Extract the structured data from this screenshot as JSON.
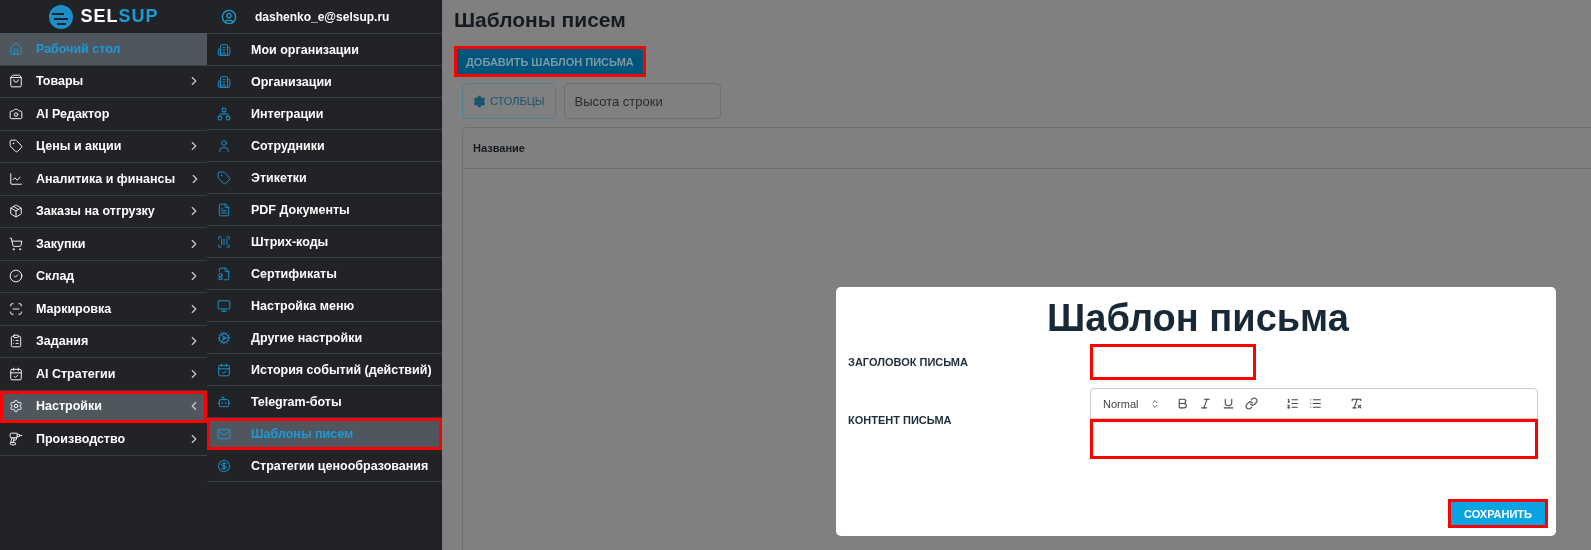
{
  "logo": {
    "first": "SEL",
    "second": "SUP"
  },
  "sidebar": {
    "items": [
      {
        "kind": "link",
        "label": "Рабочий стол",
        "selected": true,
        "highlighted": false
      },
      {
        "kind": "group",
        "label": "Товары",
        "selected": false,
        "expanded": false,
        "highlighted": false
      },
      {
        "kind": "link",
        "label": "AI Редактор",
        "selected": false,
        "highlighted": false
      },
      {
        "kind": "group",
        "label": "Цены и акции",
        "selected": false,
        "expanded": false,
        "highlighted": false
      },
      {
        "kind": "group",
        "label": "Аналитика и финансы",
        "selected": false,
        "expanded": false,
        "highlighted": false
      },
      {
        "kind": "group",
        "label": "Заказы на отгрузку",
        "selected": false,
        "expanded": false,
        "highlighted": false
      },
      {
        "kind": "group",
        "label": "Закупки",
        "selected": false,
        "expanded": false,
        "highlighted": false
      },
      {
        "kind": "group",
        "label": "Склад",
        "selected": false,
        "expanded": false,
        "highlighted": false
      },
      {
        "kind": "group",
        "label": "Маркировка",
        "selected": false,
        "expanded": false,
        "highlighted": false
      },
      {
        "kind": "group",
        "label": "Задания",
        "selected": false,
        "expanded": false,
        "highlighted": false
      },
      {
        "kind": "group",
        "label": "AI Стратегии",
        "selected": false,
        "expanded": false,
        "highlighted": false
      },
      {
        "kind": "group",
        "label": "Настройки",
        "selected": true,
        "expanded": true,
        "highlighted": true
      },
      {
        "kind": "group",
        "label": "Производство",
        "selected": false,
        "expanded": false,
        "highlighted": false
      }
    ]
  },
  "submenu": {
    "user": "dashenko_e@selsup.ru",
    "items": [
      {
        "label": "Мои организации",
        "selected": false,
        "highlighted": false
      },
      {
        "label": "Организации",
        "selected": false,
        "highlighted": false
      },
      {
        "label": "Интеграции",
        "selected": false,
        "highlighted": false
      },
      {
        "label": "Сотрудники",
        "selected": false,
        "highlighted": false
      },
      {
        "label": "Этикетки",
        "selected": false,
        "highlighted": false
      },
      {
        "label": "PDF Документы",
        "selected": false,
        "highlighted": false
      },
      {
        "label": "Штрих-коды",
        "selected": false,
        "highlighted": false
      },
      {
        "label": "Сертификаты",
        "selected": false,
        "highlighted": false
      },
      {
        "label": "Настройка меню",
        "selected": false,
        "highlighted": false
      },
      {
        "label": "Другие настройки",
        "selected": false,
        "highlighted": false
      },
      {
        "label": "История событий (действий)",
        "selected": false,
        "highlighted": false
      },
      {
        "label": "Telegram-боты",
        "selected": false,
        "highlighted": false
      },
      {
        "label": "Шаблоны писем",
        "selected": true,
        "highlighted": true
      },
      {
        "label": "Стратегии ценообразования",
        "selected": false,
        "highlighted": false
      }
    ]
  },
  "page": {
    "title": "Шаблоны писем",
    "add_button": {
      "label": "ДОБАВИТЬ ШАБЛОН ПИСЬМА",
      "highlighted": true
    },
    "columns_button": "СТОЛБЦЫ",
    "row_height": {
      "placeholder": "Высота строки"
    },
    "table": {
      "columns": [
        "Название"
      ]
    }
  },
  "modal": {
    "title": "Шаблон письма",
    "title_field": {
      "label": "ЗАГОЛОВОК ПИСЬМА",
      "highlighted": true
    },
    "content_field": {
      "label": "КОНТЕНТ ПИСЬМА",
      "format": "Normal",
      "highlighted": true
    },
    "save_button": {
      "label": "СОХРАНИТЬ",
      "highlighted": true
    }
  }
}
